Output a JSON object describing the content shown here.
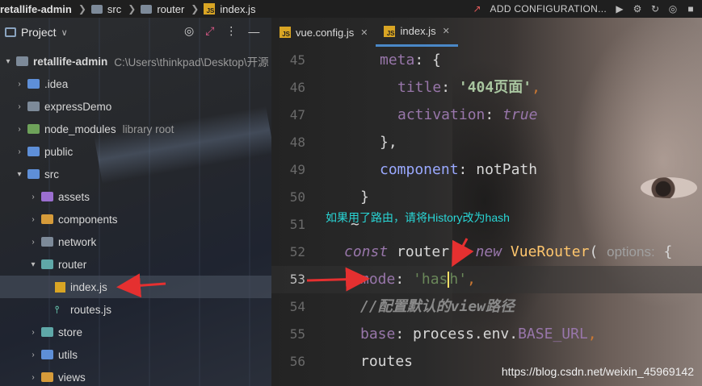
{
  "breadcrumb": {
    "project": "retallife-admin",
    "folder1": "src",
    "folder2": "router",
    "file": "index.js"
  },
  "toolbar": {
    "add_configuration": "ADD CONFIGURATION..."
  },
  "project_panel": {
    "title": "Project",
    "tree": [
      {
        "label": "retallife-admin",
        "hint": "C:\\Users\\thinkpad\\Desktop\\开源",
        "indent": 0,
        "expanded": true,
        "icon": "folder"
      },
      {
        "label": ".idea",
        "indent": 1,
        "expanded": false,
        "icon": "folder-blue"
      },
      {
        "label": "expressDemo",
        "indent": 1,
        "expanded": false,
        "icon": "folder"
      },
      {
        "label": "node_modules",
        "hint": "library root",
        "indent": 1,
        "expanded": false,
        "icon": "folder-green"
      },
      {
        "label": "public",
        "indent": 1,
        "expanded": false,
        "icon": "folder-blue"
      },
      {
        "label": "src",
        "indent": 1,
        "expanded": true,
        "icon": "folder-blue"
      },
      {
        "label": "assets",
        "indent": 2,
        "expanded": false,
        "icon": "folder-purple"
      },
      {
        "label": "components",
        "indent": 2,
        "expanded": false,
        "icon": "folder-orange"
      },
      {
        "label": "network",
        "indent": 2,
        "expanded": false,
        "icon": "folder"
      },
      {
        "label": "router",
        "indent": 2,
        "expanded": true,
        "icon": "folder-teal"
      },
      {
        "label": "index.js",
        "indent": 3,
        "selected": true,
        "icon": "js-file"
      },
      {
        "label": "routes.js",
        "indent": 3,
        "icon": "routes-file"
      },
      {
        "label": "store",
        "indent": 2,
        "expanded": false,
        "icon": "folder-teal"
      },
      {
        "label": "utils",
        "indent": 2,
        "expanded": false,
        "icon": "folder-blue"
      },
      {
        "label": "views",
        "indent": 2,
        "expanded": false,
        "icon": "folder-orange"
      }
    ]
  },
  "tabs": [
    {
      "label": "vue.config.js",
      "active": false
    },
    {
      "label": "index.js",
      "active": true
    }
  ],
  "editor": {
    "line_numbers": [
      "45",
      "46",
      "47",
      "48",
      "49",
      "50",
      "51",
      "52",
      "53",
      "54",
      "55",
      "56"
    ],
    "lines": {
      "l45_prop": "meta",
      "l45_rest": ": {",
      "l46_prop": "title",
      "l46_colon": ": ",
      "l46_str_a": "'404",
      "l46_str_b": "页面",
      "l46_str_c": "'",
      "l46_end": ",",
      "l47_prop": "activation",
      "l47_colon": ": ",
      "l47_val": "true",
      "l48": "},",
      "l49_prop": "component",
      "l49_colon": ": ",
      "l49_val": "notPath",
      "l50": "}",
      "l51": "~",
      "l52_kw": "const",
      "l52_mid": " router = ",
      "l52_new": "new",
      "l52_fn": " VueRouter",
      "l52_paren": "( ",
      "l52_hint": "options:",
      "l52_end": " {",
      "l53_prop": "mode",
      "l53_colon": ": ",
      "l53_str_a": "'has",
      "l53_str_b": "h'",
      "l53_end": ",",
      "l54_cmt": "//配置默认的view路径",
      "l55_prop": "base",
      "l55_colon": ": ",
      "l55_rest": "process.env.",
      "l55_const": "BASE_URL",
      "l55_end": ",",
      "l56": "routes"
    }
  },
  "annotation": "如果用了路由，请将History改为hash",
  "watermark": "https://blog.csdn.net/weixin_45969142",
  "colors": {
    "accent": "#4a88c7",
    "annotation": "#29d6d6",
    "arrow": "#e53030"
  }
}
